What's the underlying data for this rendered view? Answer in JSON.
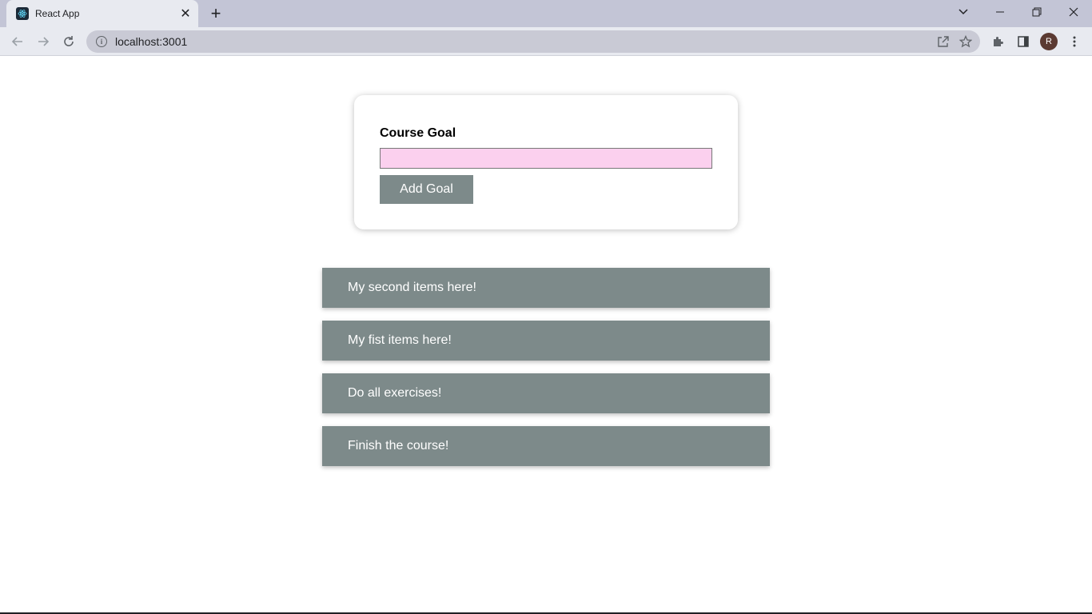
{
  "browser": {
    "tab_title": "React App",
    "url": "localhost:3001",
    "profile_initial": "R"
  },
  "form": {
    "label": "Course Goal",
    "input_value": "",
    "button_label": "Add Goal"
  },
  "goals": [
    "My second items here!",
    "My fist items here!",
    "Do all exercises!",
    "Finish the course!"
  ],
  "colors": {
    "item_bg": "#7d8a8a",
    "input_bg": "#fbd0ee"
  }
}
